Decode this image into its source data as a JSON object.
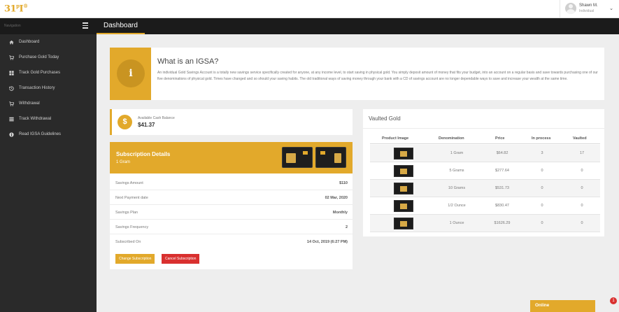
{
  "app": {
    "logo_main": "31",
    "logo_sup": "p",
    "logo_end": "I",
    "logo_sup2": "®"
  },
  "user": {
    "name": "Shawn M.",
    "role": "Individual"
  },
  "nav": {
    "title": "Navigation",
    "page_title": "Dashboard",
    "items": [
      {
        "label": "Dashboard",
        "icon": "home-icon"
      },
      {
        "label": "Purchase Gold Today",
        "icon": "cart-icon"
      },
      {
        "label": "Track Gold Purchases",
        "icon": "grid-icon"
      },
      {
        "label": "Transaction History",
        "icon": "history-icon"
      },
      {
        "label": "Withdrawal",
        "icon": "cart-icon"
      },
      {
        "label": "Track Withdrawal",
        "icon": "list-icon"
      },
      {
        "label": "Read IGSA Guidelines",
        "icon": "info-icon"
      }
    ]
  },
  "info": {
    "icon_letter": "i",
    "title": "What is an IGSA?",
    "text": "An individual Gold Savings Account is a totally new savings service specifically created for anyone, at any income level, to start saving in physical gold. You simply deposit amount of money that fits your budget, into an account on a regular basis and save towards purchasing one of our five denominations of physical gold. Times have changed and so should your saving habits. The old traditional ways of saving money through your bank with a CD of savings account are no longer dependable ways to save and increase your wealth at the same time."
  },
  "cash": {
    "symbol": "$",
    "label": "Available Cash Balance",
    "value": "$41.37"
  },
  "subscription": {
    "title": "Subscription Details",
    "subtitle": "1 Gram",
    "rows": [
      {
        "key": "Savings Amount",
        "value": "$110"
      },
      {
        "key": "Next Payment date",
        "value": "02 Mar, 2020"
      },
      {
        "key": "Savings Plan",
        "value": "Monthly"
      },
      {
        "key": "Savings Frequency",
        "value": "2"
      },
      {
        "key": "Subscribed On",
        "value": "14 Oct, 2019 (6:27 PM)"
      }
    ],
    "change_label": "Change Subscription",
    "cancel_label": "Cancel Subscription"
  },
  "vault": {
    "title": "Vaulted Gold",
    "headers": [
      "Product Image",
      "Denomination",
      "Price",
      "In process",
      "Vaulted"
    ],
    "rows": [
      {
        "denomination": "1 Gram",
        "price": "$64.82",
        "in_process": "3",
        "vaulted": "17"
      },
      {
        "denomination": "5 Grams",
        "price": "$277.64",
        "in_process": "0",
        "vaulted": "0"
      },
      {
        "denomination": "10 Grams",
        "price": "$531.73",
        "in_process": "0",
        "vaulted": "0"
      },
      {
        "denomination": "1/2 Ounce",
        "price": "$830.47",
        "in_process": "0",
        "vaulted": "0"
      },
      {
        "denomination": "1 Ounce",
        "price": "$1626.29",
        "in_process": "0",
        "vaulted": "0"
      }
    ]
  },
  "chat": {
    "label": "Online",
    "badge": "1"
  },
  "colors": {
    "accent": "#e2a92b",
    "danger": "#d9302f",
    "sidebar": "#2a2a2a",
    "header": "#1b1b1b"
  }
}
